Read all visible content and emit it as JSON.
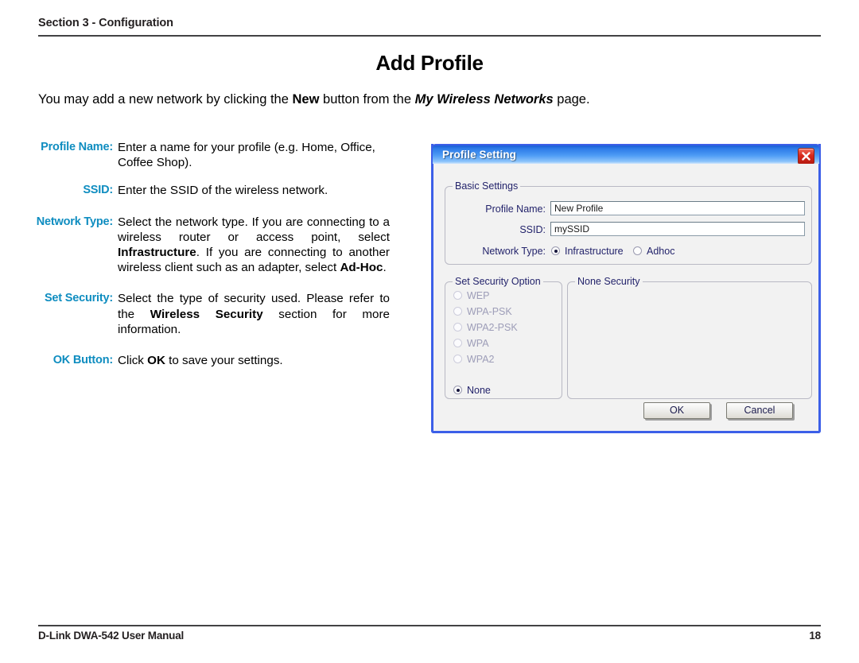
{
  "header": {
    "section_label": "Section 3 - Configuration"
  },
  "footer": {
    "left": "D-Link DWA-542 User Manual",
    "page_number": "18"
  },
  "page": {
    "title": "Add Profile",
    "intro": {
      "part1": "You may add a new network by clicking the ",
      "bold1": "New",
      "part2": " button from the ",
      "italic1": "My Wireless Networks",
      "part3": " page."
    }
  },
  "descriptions": [
    {
      "term": "Profile Name:",
      "text": "Enter a name for your profile (e.g. Home, Office, Coffee Shop)."
    },
    {
      "term": "SSID:",
      "text": "Enter the SSID of the wireless network."
    },
    {
      "term": "Network Type:",
      "seg1": "Select the network type. If you are connecting to a wireless router or access point, select ",
      "bold1": "Infrastructure",
      "seg2": ". If you are connecting to another wireless client such as an adapter, select ",
      "bold2": "Ad-Hoc",
      "seg3": "."
    },
    {
      "term": "Set Security:",
      "seg1": "Select the type of security used. Please refer to the ",
      "bold1": "Wireless Security",
      "seg2": " section for more information."
    },
    {
      "term": "OK Button:",
      "seg1": "Click ",
      "bold1": "OK",
      "seg2": " to save your settings."
    }
  ],
  "dialog": {
    "title": "Profile Setting",
    "close_icon": "close-icon",
    "basic_settings": {
      "legend": "Basic Settings",
      "profile_name_label": "Profile Name:",
      "profile_name_value": "New Profile",
      "ssid_label": "SSID:",
      "ssid_value": "mySSID",
      "network_type_label": "Network Type:",
      "network_type_options": [
        {
          "label": "Infrastructure",
          "selected": true
        },
        {
          "label": "Adhoc",
          "selected": false
        }
      ]
    },
    "security_option": {
      "legend": "Set Security Option",
      "options": [
        {
          "label": "WEP",
          "selected": false,
          "enabled": false
        },
        {
          "label": "WPA-PSK",
          "selected": false,
          "enabled": false
        },
        {
          "label": "WPA2-PSK",
          "selected": false,
          "enabled": false
        },
        {
          "label": "WPA",
          "selected": false,
          "enabled": false
        },
        {
          "label": "WPA2",
          "selected": false,
          "enabled": false
        },
        {
          "label": "None",
          "selected": true,
          "enabled": true
        }
      ]
    },
    "security_detail": {
      "legend": "None Security"
    },
    "buttons": {
      "ok": "OK",
      "cancel": "Cancel"
    }
  },
  "colors": {
    "term_blue": "#0f8dc0",
    "titlebar_blue": "#2e7ce8",
    "dialog_border": "#3c5fe8",
    "close_red": "#d8291c",
    "dialog_text": "#23236b"
  }
}
